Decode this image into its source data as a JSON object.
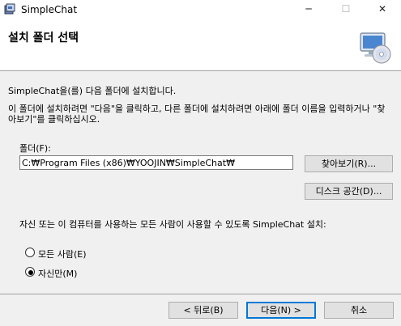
{
  "window": {
    "title": "SimpleChat",
    "minimize_glyph": "─",
    "maximize_glyph": "☐",
    "close_glyph": "✕"
  },
  "header": {
    "title": "설치 폴더 선택",
    "icon": "computer-cd-icon"
  },
  "body": {
    "intro": "SimpleChat을(를) 다음 폴더에 설치합니다.",
    "instructions": "이 폴더에 설치하려면 \"다음\"을 클릭하고, 다른 폴더에 설치하려면 아래에 폴더 이름을 입력하거나 \"찾아보기\"를 클릭하십시오.",
    "folder_label": "폴더(F):",
    "folder_value": "C:₩Program Files (x86)₩YOOJIN₩SimpleChat₩",
    "browse_label": "찾아보기(R)...",
    "disk_space_label": "디스크 공간(D)...",
    "install_for_text": "자신 또는 이 컴퓨터를 사용하는 모든 사람이 사용할 수 있도록 SimpleChat 설치:",
    "options": [
      {
        "label": "모든 사람(E)",
        "selected": false
      },
      {
        "label": "자신만(M)",
        "selected": true
      }
    ]
  },
  "footer": {
    "back_label": "< 뒤로(B)",
    "next_label": "다음(N) >",
    "cancel_label": "취소"
  },
  "colors": {
    "accent": "#0078d7",
    "window_bg": "#f0f0f0",
    "header_bg": "#ffffff"
  }
}
